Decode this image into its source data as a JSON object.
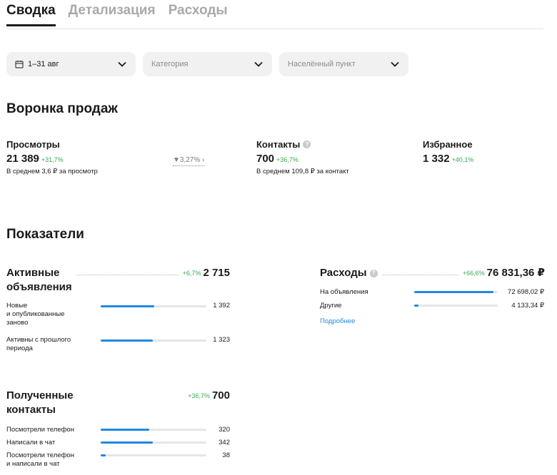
{
  "tabs": [
    {
      "label": "Сводка",
      "active": true
    },
    {
      "label": "Детализация",
      "active": false
    },
    {
      "label": "Расходы",
      "active": false
    }
  ],
  "filters": {
    "date": "1–31 авг",
    "category_placeholder": "Категория",
    "city_placeholder": "Населённый пункт"
  },
  "funnel": {
    "title": "Воронка продаж",
    "views": {
      "title": "Просмотры",
      "value": "21 389",
      "delta": "+31,7%",
      "sub": "В среднем 3,6 ₽ за просмотр"
    },
    "conversion": "3,27%",
    "contacts": {
      "title": "Контакты",
      "value": "700",
      "delta": "+36,7%",
      "sub": "В среднем 109,8 ₽ за контакт"
    },
    "favorites": {
      "title": "Избранное",
      "value": "1 332",
      "delta": "+40,1%"
    }
  },
  "metrics": {
    "title": "Показатели",
    "active_ads": {
      "title_line1": "Активные",
      "title_line2": "объявления",
      "delta": "+6,7%",
      "value": "2 715",
      "rows": [
        {
          "label_lines": [
            "Новые",
            "и опубликованные",
            "заново"
          ],
          "value": "1 392",
          "fraction": 0.51
        },
        {
          "label_lines": [
            "Активны с прошлого",
            "периода"
          ],
          "value": "1 323",
          "fraction": 0.49
        }
      ]
    },
    "expenses": {
      "title": "Расходы",
      "delta": "+66,6%",
      "value": "76 831,36 ₽",
      "rows": [
        {
          "label": "На объявления",
          "value": "72 698,02 ₽",
          "fraction": 0.95
        },
        {
          "label": "Другие",
          "value": "4 133,34 ₽",
          "fraction": 0.05
        }
      ],
      "more_link": "Подробнее"
    },
    "contacts": {
      "title_line1": "Полученные",
      "title_line2": "контакты",
      "delta": "+36,7%",
      "value": "700",
      "rows": [
        {
          "label_lines": [
            "Посмотрели телефон"
          ],
          "value": "320",
          "fraction": 0.46
        },
        {
          "label_lines": [
            "Написали в чат"
          ],
          "value": "342",
          "fraction": 0.49
        },
        {
          "label_lines": [
            "Посмотрели телефон",
            "и написали в чат"
          ],
          "value": "38",
          "fraction": 0.05
        }
      ]
    }
  },
  "colors": {
    "accent": "#1e88e5",
    "positive": "#2fb04e",
    "muted": "#a9a9a9"
  },
  "icons": {
    "calendar": "calendar-icon",
    "chevron": "chevron-down-icon",
    "help": "help-icon",
    "conversion": "funnel-icon"
  }
}
